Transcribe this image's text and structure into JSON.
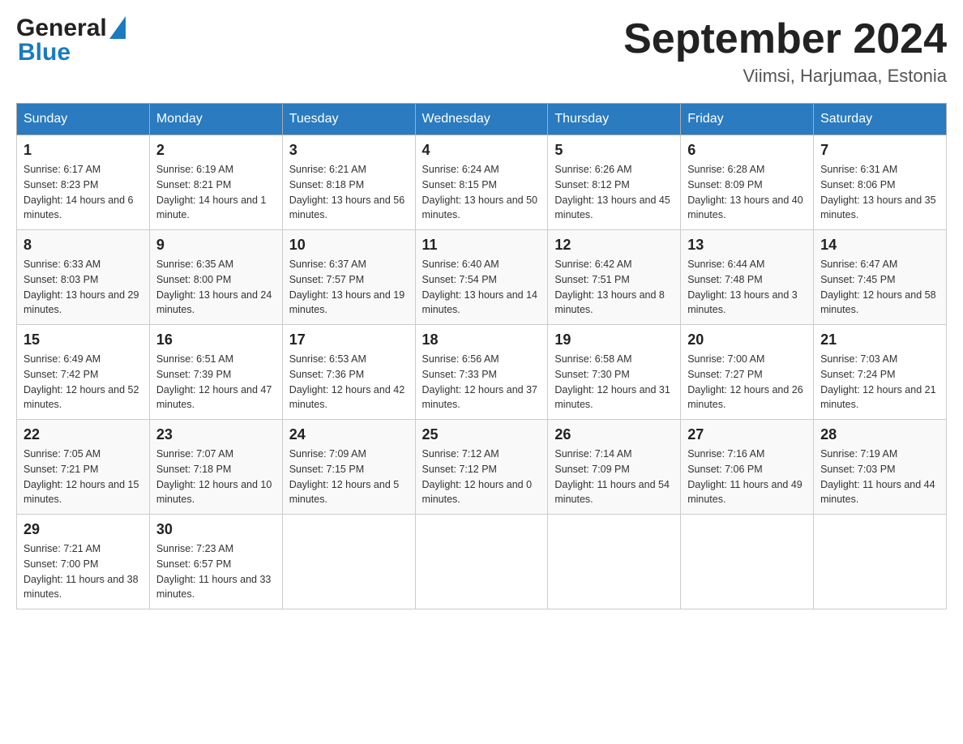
{
  "header": {
    "logo_general": "General",
    "logo_blue": "Blue",
    "main_title": "September 2024",
    "subtitle": "Viimsi, Harjumaa, Estonia"
  },
  "calendar": {
    "days_of_week": [
      "Sunday",
      "Monday",
      "Tuesday",
      "Wednesday",
      "Thursday",
      "Friday",
      "Saturday"
    ],
    "weeks": [
      [
        {
          "day": "1",
          "sunrise": "Sunrise: 6:17 AM",
          "sunset": "Sunset: 8:23 PM",
          "daylight": "Daylight: 14 hours and 6 minutes."
        },
        {
          "day": "2",
          "sunrise": "Sunrise: 6:19 AM",
          "sunset": "Sunset: 8:21 PM",
          "daylight": "Daylight: 14 hours and 1 minute."
        },
        {
          "day": "3",
          "sunrise": "Sunrise: 6:21 AM",
          "sunset": "Sunset: 8:18 PM",
          "daylight": "Daylight: 13 hours and 56 minutes."
        },
        {
          "day": "4",
          "sunrise": "Sunrise: 6:24 AM",
          "sunset": "Sunset: 8:15 PM",
          "daylight": "Daylight: 13 hours and 50 minutes."
        },
        {
          "day": "5",
          "sunrise": "Sunrise: 6:26 AM",
          "sunset": "Sunset: 8:12 PM",
          "daylight": "Daylight: 13 hours and 45 minutes."
        },
        {
          "day": "6",
          "sunrise": "Sunrise: 6:28 AM",
          "sunset": "Sunset: 8:09 PM",
          "daylight": "Daylight: 13 hours and 40 minutes."
        },
        {
          "day": "7",
          "sunrise": "Sunrise: 6:31 AM",
          "sunset": "Sunset: 8:06 PM",
          "daylight": "Daylight: 13 hours and 35 minutes."
        }
      ],
      [
        {
          "day": "8",
          "sunrise": "Sunrise: 6:33 AM",
          "sunset": "Sunset: 8:03 PM",
          "daylight": "Daylight: 13 hours and 29 minutes."
        },
        {
          "day": "9",
          "sunrise": "Sunrise: 6:35 AM",
          "sunset": "Sunset: 8:00 PM",
          "daylight": "Daylight: 13 hours and 24 minutes."
        },
        {
          "day": "10",
          "sunrise": "Sunrise: 6:37 AM",
          "sunset": "Sunset: 7:57 PM",
          "daylight": "Daylight: 13 hours and 19 minutes."
        },
        {
          "day": "11",
          "sunrise": "Sunrise: 6:40 AM",
          "sunset": "Sunset: 7:54 PM",
          "daylight": "Daylight: 13 hours and 14 minutes."
        },
        {
          "day": "12",
          "sunrise": "Sunrise: 6:42 AM",
          "sunset": "Sunset: 7:51 PM",
          "daylight": "Daylight: 13 hours and 8 minutes."
        },
        {
          "day": "13",
          "sunrise": "Sunrise: 6:44 AM",
          "sunset": "Sunset: 7:48 PM",
          "daylight": "Daylight: 13 hours and 3 minutes."
        },
        {
          "day": "14",
          "sunrise": "Sunrise: 6:47 AM",
          "sunset": "Sunset: 7:45 PM",
          "daylight": "Daylight: 12 hours and 58 minutes."
        }
      ],
      [
        {
          "day": "15",
          "sunrise": "Sunrise: 6:49 AM",
          "sunset": "Sunset: 7:42 PM",
          "daylight": "Daylight: 12 hours and 52 minutes."
        },
        {
          "day": "16",
          "sunrise": "Sunrise: 6:51 AM",
          "sunset": "Sunset: 7:39 PM",
          "daylight": "Daylight: 12 hours and 47 minutes."
        },
        {
          "day": "17",
          "sunrise": "Sunrise: 6:53 AM",
          "sunset": "Sunset: 7:36 PM",
          "daylight": "Daylight: 12 hours and 42 minutes."
        },
        {
          "day": "18",
          "sunrise": "Sunrise: 6:56 AM",
          "sunset": "Sunset: 7:33 PM",
          "daylight": "Daylight: 12 hours and 37 minutes."
        },
        {
          "day": "19",
          "sunrise": "Sunrise: 6:58 AM",
          "sunset": "Sunset: 7:30 PM",
          "daylight": "Daylight: 12 hours and 31 minutes."
        },
        {
          "day": "20",
          "sunrise": "Sunrise: 7:00 AM",
          "sunset": "Sunset: 7:27 PM",
          "daylight": "Daylight: 12 hours and 26 minutes."
        },
        {
          "day": "21",
          "sunrise": "Sunrise: 7:03 AM",
          "sunset": "Sunset: 7:24 PM",
          "daylight": "Daylight: 12 hours and 21 minutes."
        }
      ],
      [
        {
          "day": "22",
          "sunrise": "Sunrise: 7:05 AM",
          "sunset": "Sunset: 7:21 PM",
          "daylight": "Daylight: 12 hours and 15 minutes."
        },
        {
          "day": "23",
          "sunrise": "Sunrise: 7:07 AM",
          "sunset": "Sunset: 7:18 PM",
          "daylight": "Daylight: 12 hours and 10 minutes."
        },
        {
          "day": "24",
          "sunrise": "Sunrise: 7:09 AM",
          "sunset": "Sunset: 7:15 PM",
          "daylight": "Daylight: 12 hours and 5 minutes."
        },
        {
          "day": "25",
          "sunrise": "Sunrise: 7:12 AM",
          "sunset": "Sunset: 7:12 PM",
          "daylight": "Daylight: 12 hours and 0 minutes."
        },
        {
          "day": "26",
          "sunrise": "Sunrise: 7:14 AM",
          "sunset": "Sunset: 7:09 PM",
          "daylight": "Daylight: 11 hours and 54 minutes."
        },
        {
          "day": "27",
          "sunrise": "Sunrise: 7:16 AM",
          "sunset": "Sunset: 7:06 PM",
          "daylight": "Daylight: 11 hours and 49 minutes."
        },
        {
          "day": "28",
          "sunrise": "Sunrise: 7:19 AM",
          "sunset": "Sunset: 7:03 PM",
          "daylight": "Daylight: 11 hours and 44 minutes."
        }
      ],
      [
        {
          "day": "29",
          "sunrise": "Sunrise: 7:21 AM",
          "sunset": "Sunset: 7:00 PM",
          "daylight": "Daylight: 11 hours and 38 minutes."
        },
        {
          "day": "30",
          "sunrise": "Sunrise: 7:23 AM",
          "sunset": "Sunset: 6:57 PM",
          "daylight": "Daylight: 11 hours and 33 minutes."
        },
        null,
        null,
        null,
        null,
        null
      ]
    ]
  }
}
